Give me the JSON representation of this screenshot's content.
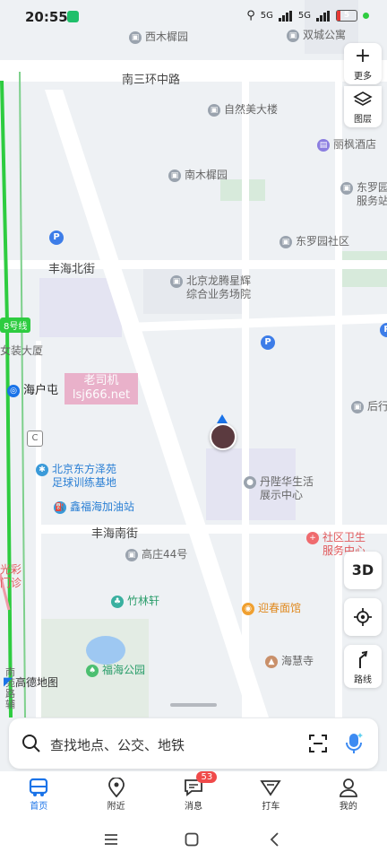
{
  "status_bar": {
    "time": "20:55",
    "network": "5G",
    "network2": "5G",
    "battery": "5",
    "battery_level": 0.2
  },
  "map": {
    "roads": {
      "nan_sanhuan": "南三环中路",
      "fenghai_north": "丰海北街",
      "fenghai_south": "丰海南街",
      "line8": "8号线"
    },
    "pois": [
      {
        "id": "xi_mu_xi_yuan",
        "name": "西木樨园"
      },
      {
        "id": "shuangcheng",
        "name": "双城公寓"
      },
      {
        "id": "ziran_mei",
        "name": "自然美大楼"
      },
      {
        "id": "lifeng",
        "name": "丽枫酒店"
      },
      {
        "id": "nan_mu_xi_yuan",
        "name": "南木樨园"
      },
      {
        "id": "dongluo_service",
        "name": "东罗园\n服务站"
      },
      {
        "id": "dongluo_4",
        "name": "东罗园社区"
      },
      {
        "id": "longteng",
        "name": "北京龙腾星辉\n综合业务场院"
      },
      {
        "id": "nvzhuang",
        "name": "女装大厦"
      },
      {
        "id": "haihutun",
        "name": "海户屯"
      },
      {
        "id": "houxing",
        "name": "后行"
      },
      {
        "id": "dongfang_ze",
        "name": "北京东方泽苑\n足球训练基地"
      },
      {
        "id": "xinfuhai_gas",
        "name": "鑫福海加油站"
      },
      {
        "id": "danlong",
        "name": "丹陛华生活\n展示中心"
      },
      {
        "id": "shequ_weisheng",
        "name": "社区卫生\n服务中心"
      },
      {
        "id": "gaozhuang",
        "name": "高庄44号"
      },
      {
        "id": "zhulin",
        "name": "竹林轩"
      },
      {
        "id": "yingchun",
        "name": "迎春面馆"
      },
      {
        "id": "fuhai_park",
        "name": "福海公园"
      },
      {
        "id": "haihui_temple",
        "name": "海慧寺"
      },
      {
        "id": "guangcai",
        "name": "光彩\n门诊"
      },
      {
        "id": "nanyuan_road",
        "name": "南\n苑\n路\n辅"
      }
    ],
    "watermark": {
      "line1": "老司机",
      "line2": "lsj666.net"
    },
    "logo": "高德地图",
    "marker_c": "C"
  },
  "controls": {
    "more": {
      "label": "更多",
      "icon": "plus-icon"
    },
    "layers": {
      "label": "图层",
      "icon": "layers-icon"
    },
    "three_d": {
      "label": "3D"
    },
    "locate": {
      "icon": "locate-icon"
    },
    "route": {
      "label": "路线",
      "icon": "route-icon"
    }
  },
  "search": {
    "placeholder": "查找地点、公交、地铁"
  },
  "tabs": [
    {
      "label": "首页",
      "icon": "bus-icon",
      "active": true
    },
    {
      "label": "附近",
      "icon": "pin-icon"
    },
    {
      "label": "消息",
      "icon": "message-icon",
      "badge": "53"
    },
    {
      "label": "打车",
      "icon": "taxi-icon"
    },
    {
      "label": "我的",
      "icon": "user-icon"
    }
  ],
  "colors": {
    "accent": "#1a73e8",
    "metro": "#2ecc40",
    "badge": "#f04a4a"
  }
}
